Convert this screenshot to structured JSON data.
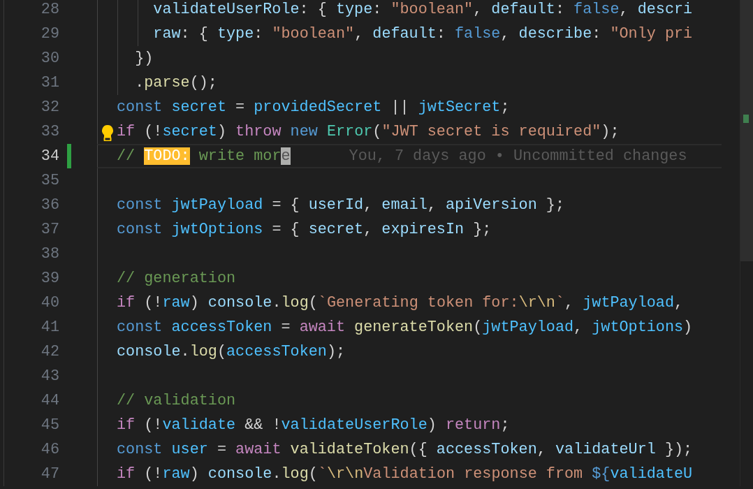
{
  "editor": {
    "lines": [
      {
        "number": "28",
        "current": false,
        "modified": false,
        "lightbulb": false,
        "tokens": [
          {
            "kind": "prop",
            "text": "    validateUserRole"
          },
          {
            "kind": "punct",
            "text": ": { "
          },
          {
            "kind": "prop",
            "text": "type"
          },
          {
            "kind": "punct",
            "text": ": "
          },
          {
            "kind": "string",
            "text": "\"boolean\""
          },
          {
            "kind": "punct",
            "text": ", "
          },
          {
            "kind": "prop",
            "text": "default"
          },
          {
            "kind": "punct",
            "text": ": "
          },
          {
            "kind": "keyword",
            "text": "false"
          },
          {
            "kind": "punct",
            "text": ", "
          },
          {
            "kind": "prop",
            "text": "descri"
          }
        ]
      },
      {
        "number": "29",
        "current": false,
        "modified": false,
        "lightbulb": false,
        "tokens": [
          {
            "kind": "prop",
            "text": "    raw"
          },
          {
            "kind": "punct",
            "text": ": { "
          },
          {
            "kind": "prop",
            "text": "type"
          },
          {
            "kind": "punct",
            "text": ": "
          },
          {
            "kind": "string",
            "text": "\"boolean\""
          },
          {
            "kind": "punct",
            "text": ", "
          },
          {
            "kind": "prop",
            "text": "default"
          },
          {
            "kind": "punct",
            "text": ": "
          },
          {
            "kind": "keyword",
            "text": "false"
          },
          {
            "kind": "punct",
            "text": ", "
          },
          {
            "kind": "prop",
            "text": "describe"
          },
          {
            "kind": "punct",
            "text": ": "
          },
          {
            "kind": "string",
            "text": "\"Only pri"
          }
        ]
      },
      {
        "number": "30",
        "current": false,
        "modified": false,
        "lightbulb": false,
        "tokens": [
          {
            "kind": "punct",
            "text": "  })"
          }
        ]
      },
      {
        "number": "31",
        "current": false,
        "modified": false,
        "lightbulb": false,
        "tokens": [
          {
            "kind": "punct",
            "text": "  ."
          },
          {
            "kind": "func",
            "text": "parse"
          },
          {
            "kind": "punct",
            "text": "();"
          }
        ]
      },
      {
        "number": "32",
        "current": false,
        "modified": false,
        "lightbulb": false,
        "tokens": [
          {
            "kind": "keyword",
            "text": "const "
          },
          {
            "kind": "var",
            "text": "secret"
          },
          {
            "kind": "punct",
            "text": " = "
          },
          {
            "kind": "var",
            "text": "providedSecret"
          },
          {
            "kind": "punct",
            "text": " || "
          },
          {
            "kind": "var",
            "text": "jwtSecret"
          },
          {
            "kind": "punct",
            "text": ";"
          }
        ]
      },
      {
        "number": "33",
        "current": false,
        "modified": false,
        "lightbulb": true,
        "tokens": [
          {
            "kind": "control",
            "text": "if"
          },
          {
            "kind": "punct",
            "text": " (!"
          },
          {
            "kind": "var",
            "text": "secret"
          },
          {
            "kind": "punct",
            "text": ") "
          },
          {
            "kind": "control",
            "text": "throw "
          },
          {
            "kind": "keyword",
            "text": "new "
          },
          {
            "kind": "class",
            "text": "Error"
          },
          {
            "kind": "punct",
            "text": "("
          },
          {
            "kind": "string",
            "text": "\"JWT secret is required\""
          },
          {
            "kind": "punct",
            "text": ");"
          }
        ]
      },
      {
        "number": "34",
        "current": true,
        "modified": true,
        "lightbulb": false,
        "blame": "You, 7 days ago • Uncommitted changes",
        "tokens": [
          {
            "kind": "comment",
            "text": "// "
          },
          {
            "kind": "todo",
            "text": "TODO:"
          },
          {
            "kind": "comment",
            "text": " write mor"
          },
          {
            "kind": "cursor",
            "text": "e"
          }
        ]
      },
      {
        "number": "35",
        "current": false,
        "modified": false,
        "lightbulb": false
      },
      {
        "number": "36",
        "current": false,
        "modified": false,
        "lightbulb": false,
        "tokens": [
          {
            "kind": "keyword",
            "text": "const "
          },
          {
            "kind": "var",
            "text": "jwtPayload"
          },
          {
            "kind": "punct",
            "text": " = { "
          },
          {
            "kind": "prop",
            "text": "userId"
          },
          {
            "kind": "punct",
            "text": ", "
          },
          {
            "kind": "prop",
            "text": "email"
          },
          {
            "kind": "punct",
            "text": ", "
          },
          {
            "kind": "prop",
            "text": "apiVersion"
          },
          {
            "kind": "punct",
            "text": " };"
          }
        ]
      },
      {
        "number": "37",
        "current": false,
        "modified": false,
        "lightbulb": false,
        "tokens": [
          {
            "kind": "keyword",
            "text": "const "
          },
          {
            "kind": "var",
            "text": "jwtOptions"
          },
          {
            "kind": "punct",
            "text": " = { "
          },
          {
            "kind": "prop",
            "text": "secret"
          },
          {
            "kind": "punct",
            "text": ", "
          },
          {
            "kind": "prop",
            "text": "expiresIn"
          },
          {
            "kind": "punct",
            "text": " };"
          }
        ]
      },
      {
        "number": "38",
        "current": false,
        "modified": false,
        "lightbulb": false
      },
      {
        "number": "39",
        "current": false,
        "modified": false,
        "lightbulb": false,
        "tokens": [
          {
            "kind": "comment",
            "text": "// generation"
          }
        ]
      },
      {
        "number": "40",
        "current": false,
        "modified": false,
        "lightbulb": false,
        "tokens": [
          {
            "kind": "control",
            "text": "if"
          },
          {
            "kind": "punct",
            "text": " (!"
          },
          {
            "kind": "var",
            "text": "raw"
          },
          {
            "kind": "punct",
            "text": ") "
          },
          {
            "kind": "prop",
            "text": "console"
          },
          {
            "kind": "punct",
            "text": "."
          },
          {
            "kind": "func",
            "text": "log"
          },
          {
            "kind": "punct",
            "text": "("
          },
          {
            "kind": "string",
            "text": "`Generating token for:"
          },
          {
            "kind": "escape",
            "text": "\\r\\n"
          },
          {
            "kind": "string",
            "text": "`"
          },
          {
            "kind": "punct",
            "text": ", "
          },
          {
            "kind": "var",
            "text": "jwtPayload"
          },
          {
            "kind": "punct",
            "text": ","
          }
        ]
      },
      {
        "number": "41",
        "current": false,
        "modified": false,
        "lightbulb": false,
        "tokens": [
          {
            "kind": "keyword",
            "text": "const "
          },
          {
            "kind": "var",
            "text": "accessToken"
          },
          {
            "kind": "punct",
            "text": " = "
          },
          {
            "kind": "control",
            "text": "await "
          },
          {
            "kind": "func",
            "text": "generateToken"
          },
          {
            "kind": "punct",
            "text": "("
          },
          {
            "kind": "var",
            "text": "jwtPayload"
          },
          {
            "kind": "punct",
            "text": ", "
          },
          {
            "kind": "var",
            "text": "jwtOptions"
          },
          {
            "kind": "punct",
            "text": ")"
          }
        ]
      },
      {
        "number": "42",
        "current": false,
        "modified": false,
        "lightbulb": false,
        "tokens": [
          {
            "kind": "prop",
            "text": "console"
          },
          {
            "kind": "punct",
            "text": "."
          },
          {
            "kind": "func",
            "text": "log"
          },
          {
            "kind": "punct",
            "text": "("
          },
          {
            "kind": "var",
            "text": "accessToken"
          },
          {
            "kind": "punct",
            "text": ");"
          }
        ]
      },
      {
        "number": "43",
        "current": false,
        "modified": false,
        "lightbulb": false
      },
      {
        "number": "44",
        "current": false,
        "modified": false,
        "lightbulb": false,
        "tokens": [
          {
            "kind": "comment",
            "text": "// validation"
          }
        ]
      },
      {
        "number": "45",
        "current": false,
        "modified": false,
        "lightbulb": false,
        "tokens": [
          {
            "kind": "control",
            "text": "if"
          },
          {
            "kind": "punct",
            "text": " (!"
          },
          {
            "kind": "var",
            "text": "validate"
          },
          {
            "kind": "punct",
            "text": " && !"
          },
          {
            "kind": "var",
            "text": "validateUserRole"
          },
          {
            "kind": "punct",
            "text": ") "
          },
          {
            "kind": "control",
            "text": "return"
          },
          {
            "kind": "punct",
            "text": ";"
          }
        ]
      },
      {
        "number": "46",
        "current": false,
        "modified": false,
        "lightbulb": false,
        "tokens": [
          {
            "kind": "keyword",
            "text": "const "
          },
          {
            "kind": "var",
            "text": "user"
          },
          {
            "kind": "punct",
            "text": " = "
          },
          {
            "kind": "control",
            "text": "await "
          },
          {
            "kind": "func",
            "text": "validateToken"
          },
          {
            "kind": "punct",
            "text": "({ "
          },
          {
            "kind": "prop",
            "text": "accessToken"
          },
          {
            "kind": "punct",
            "text": ", "
          },
          {
            "kind": "prop",
            "text": "validateUrl"
          },
          {
            "kind": "punct",
            "text": " });"
          }
        ]
      },
      {
        "number": "47",
        "current": false,
        "modified": false,
        "lightbulb": false,
        "tokens": [
          {
            "kind": "control",
            "text": "if"
          },
          {
            "kind": "punct",
            "text": " (!"
          },
          {
            "kind": "var",
            "text": "raw"
          },
          {
            "kind": "punct",
            "text": ") "
          },
          {
            "kind": "prop",
            "text": "console"
          },
          {
            "kind": "punct",
            "text": "."
          },
          {
            "kind": "func",
            "text": "log"
          },
          {
            "kind": "punct",
            "text": "("
          },
          {
            "kind": "string",
            "text": "`"
          },
          {
            "kind": "escape",
            "text": "\\r\\n"
          },
          {
            "kind": "string",
            "text": "Validation response from "
          },
          {
            "kind": "keyword",
            "text": "${"
          },
          {
            "kind": "var",
            "text": "validateU"
          }
        ]
      }
    ]
  }
}
